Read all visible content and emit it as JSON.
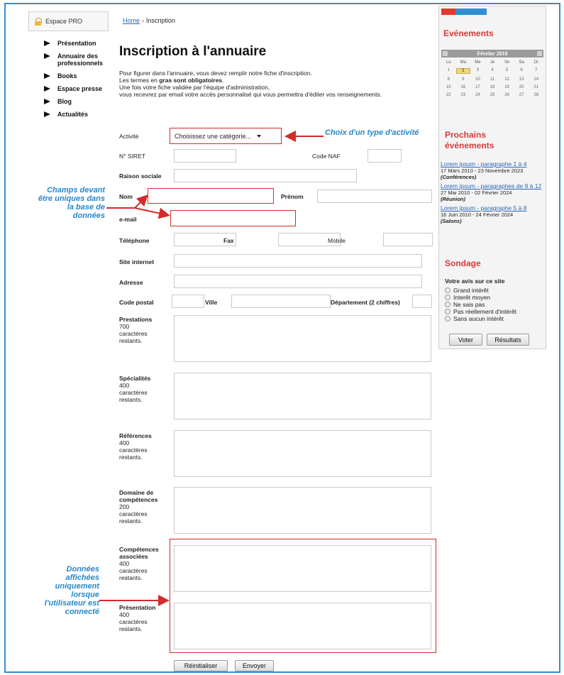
{
  "sidebar": {
    "pro_label": "Espace PRO",
    "items": [
      "Présentation",
      "Annuaire des professionnels",
      "Books",
      "Espace presse",
      "Blog",
      "Actualités"
    ]
  },
  "breadcrumb": {
    "home": "Home",
    "current": "Inscription"
  },
  "page": {
    "title": "Inscription à l'annuaire",
    "intro1": "Pour figurer dans l'annuaire, vous devez remplir notre fiche d'inscription.",
    "intro2a": "Les termes en ",
    "intro2b": "gras sont obligatoires",
    "intro2c": ".",
    "intro3": "Une fois votre fiche validée par l'équipe d'administration,",
    "intro4": "vous recevrez par email votre accès personnalisé qui vous permettra d'éditer vos renseignements."
  },
  "form": {
    "activite": "Activité",
    "activite_value": "Choisissez une catégorie...",
    "siret": "N° SIRET",
    "naf": "Code NAF",
    "raison": "Raison sociale",
    "nom": "Nom",
    "prenom": "Prénom",
    "email": "e-mail",
    "telephone": "Téléphone",
    "fax": "Fax",
    "mobile": "Mobile",
    "site": "Site internet",
    "adresse": "Adresse",
    "cp": "Code postal",
    "ville": "Ville",
    "departement": "Département (2 chiffres)",
    "remaining": "caractères restants.",
    "prestations": {
      "label": "Prestations",
      "count": "700"
    },
    "specialites": {
      "label": "Spécialités",
      "count": "400"
    },
    "references": {
      "label": "Références",
      "count": "400"
    },
    "domaine": {
      "label": "Domaine de compétences",
      "count": "200"
    },
    "associees": {
      "label": "Compétences associées",
      "count": "400"
    },
    "presentation": {
      "label": "Présentation",
      "count": "400"
    },
    "reset": "Réinitialiser",
    "submit": "Envoyer"
  },
  "annotations": {
    "activity": "Choix d'un type d'activité",
    "unique": "Champs devant être uniques dans la base de données",
    "connected": "Données affichées uniquement lorsque l'utilisateur est connecté"
  },
  "right": {
    "events_title": "Evénements",
    "calendar": {
      "month": "Février 2010",
      "days": [
        "Lu",
        "Ma",
        "Me",
        "Je",
        "Ve",
        "Sa",
        "Di"
      ],
      "rows": [
        [
          "1",
          "2",
          "3",
          "4",
          "5",
          "6",
          "7"
        ],
        [
          "8",
          "9",
          "10",
          "11",
          "12",
          "13",
          "14"
        ],
        [
          "15",
          "16",
          "17",
          "18",
          "19",
          "20",
          "21"
        ],
        [
          "22",
          "23",
          "24",
          "25",
          "26",
          "27",
          "28"
        ]
      ],
      "today": "2"
    },
    "upcoming_title": "Prochains événements",
    "events": [
      {
        "title": "Lorem ipsum - paragraphe 1 à 4",
        "dates": "17 Mars 2010 - 23 Novembre 2023",
        "category": "(Conférences)"
      },
      {
        "title": "Lorem ipsum - paragraphes de 9 à 12",
        "dates": "27 Mai 2010 - 02 Février 2024",
        "category": "(Réunion)"
      },
      {
        "title": "Lorem ipsum - paragraphe 5 à 8",
        "dates": "16 Juin 2010 - 24 Février 2024",
        "category": "(Salons)"
      }
    ],
    "poll_title": "Sondage",
    "poll_question": "Votre avis sur ce site",
    "poll_options": [
      "Grand intérêt",
      "Interêt moyen",
      "Ne sais pas",
      "Pas réellement d'intérêt",
      "Sans aucun intérêt"
    ],
    "vote": "Voter",
    "results": "Résultats"
  },
  "colors": {
    "accent_red": "#d52b2b",
    "annotation_blue": "#2787c8",
    "link_blue": "#2a66b5",
    "frame_blue": "#2f8fd0"
  }
}
